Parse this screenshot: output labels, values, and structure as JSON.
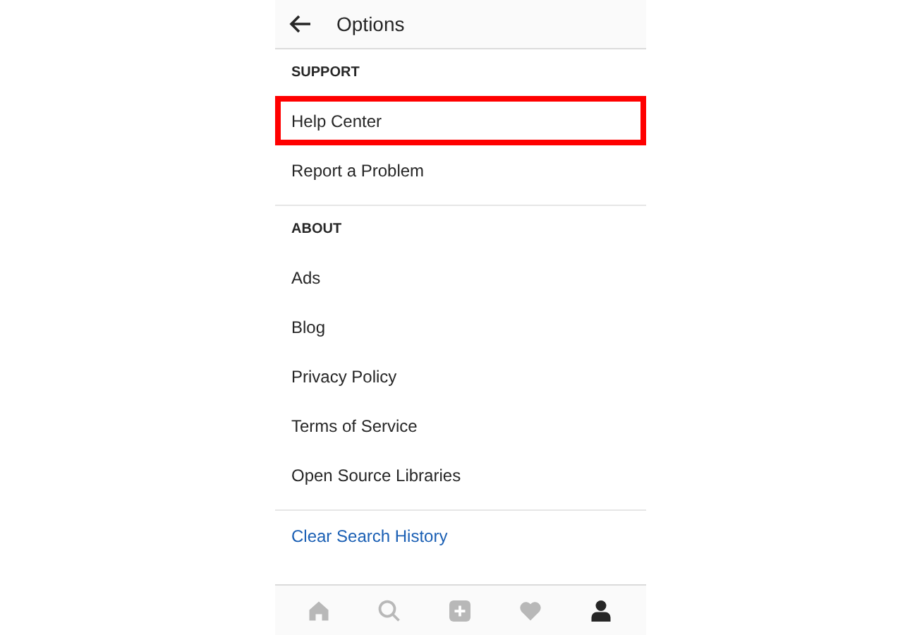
{
  "header": {
    "title": "Options"
  },
  "sections": [
    {
      "heading": "SUPPORT",
      "items": [
        {
          "label": "Help Center",
          "kind": "plain",
          "highlighted": true
        },
        {
          "label": "Report a Problem",
          "kind": "plain",
          "highlighted": false
        }
      ]
    },
    {
      "heading": "ABOUT",
      "items": [
        {
          "label": "Ads",
          "kind": "plain",
          "highlighted": false
        },
        {
          "label": "Blog",
          "kind": "plain",
          "highlighted": false
        },
        {
          "label": "Privacy Policy",
          "kind": "plain",
          "highlighted": false
        },
        {
          "label": "Terms of Service",
          "kind": "plain",
          "highlighted": false
        },
        {
          "label": "Open Source Libraries",
          "kind": "plain",
          "highlighted": false
        }
      ]
    },
    {
      "items": [
        {
          "label": "Clear Search History",
          "kind": "link",
          "highlighted": false
        }
      ]
    }
  ],
  "nav": [
    {
      "kind": "home",
      "selected": false
    },
    {
      "kind": "search",
      "selected": false
    },
    {
      "kind": "add",
      "selected": false
    },
    {
      "kind": "heart",
      "selected": false
    },
    {
      "kind": "profile",
      "selected": true
    }
  ]
}
